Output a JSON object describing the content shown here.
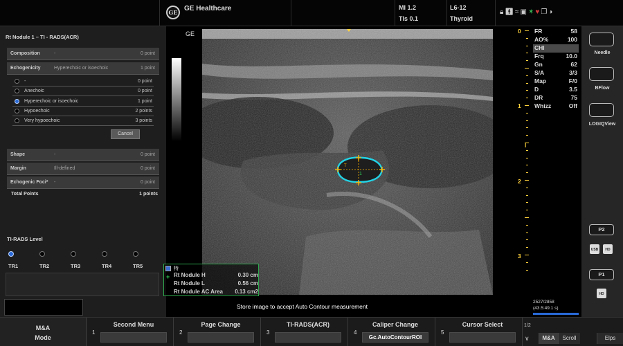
{
  "header": {
    "brand": "GE Healthcare",
    "logo_text": "GE",
    "mi": "MI 1.2",
    "tis": "TIs 0.1",
    "probe": "L6-12",
    "preset": "Thyroid",
    "status_icons": [
      "lock-icon",
      "person-icon",
      "network-icon",
      "save-icon",
      "bluetooth-icon",
      "heart-icon",
      "printer-icon",
      "contrast-icon"
    ]
  },
  "left_panel": {
    "title": "Rt Nodule 1 – TI - RADS(ACR)",
    "categories": [
      {
        "label": "Composition",
        "value": "-",
        "points": "0 point"
      },
      {
        "label": "Echogenicity",
        "value": "Hyperechoic or isoechoic",
        "points": "1 point"
      }
    ],
    "options": [
      {
        "label": "-",
        "points": "0 point",
        "selected": false
      },
      {
        "label": "Anechoic",
        "points": "0 point",
        "selected": false
      },
      {
        "label": "Hyperechoic or isoechoic",
        "points": "1 point",
        "selected": true
      },
      {
        "label": "Hypoechoic",
        "points": "2 points",
        "selected": false
      },
      {
        "label": "Very hypoechoic",
        "points": "3 points",
        "selected": false
      }
    ],
    "cancel_label": "Cancel",
    "lower_categories": [
      {
        "label": "Shape",
        "value": "-",
        "points": "0 point"
      },
      {
        "label": "Margin",
        "value": "Ill-defined",
        "points": "0 point"
      },
      {
        "label": "Echogenic Foci*",
        "value": "-",
        "points": "0 point"
      }
    ],
    "total_label": "Total Points",
    "total_value": "1 points",
    "tirads_title": "TI-RADS Level",
    "levels": [
      "TR1",
      "TR2",
      "TR3",
      "TR4",
      "TR5"
    ],
    "selected_level": "TR1"
  },
  "image": {
    "ge_tag": "GE",
    "depth_labels": [
      "0",
      "1",
      "2",
      "3"
    ],
    "focus_symbol": "I",
    "measurements": {
      "header": "特",
      "rows": [
        {
          "label": "Rt  Nodule H",
          "value": "0.30 cm"
        },
        {
          "label": "Rt  Nodule L",
          "value": "0.56 cm"
        },
        {
          "label": "Rt  Nodule AC Area",
          "value": "0.13 cm2"
        }
      ]
    },
    "message": "Store image to accept Auto Contour measurement",
    "caliper_marks": [
      "T",
      "1"
    ]
  },
  "params": [
    {
      "k": "FR",
      "v": "58"
    },
    {
      "k": "AO%",
      "v": "100"
    },
    {
      "k": "CHI",
      "v": "",
      "highlight": true
    },
    {
      "k": "Frq",
      "v": "10.0"
    },
    {
      "k": "Gn",
      "v": "62"
    },
    {
      "k": "S/A",
      "v": "3/3"
    },
    {
      "k": "Map",
      "v": "F/0"
    },
    {
      "k": "D",
      "v": "3.5"
    },
    {
      "k": "DR",
      "v": "75"
    },
    {
      "k": "Whizz",
      "v": "Off"
    }
  ],
  "frame": {
    "count": "2527/2858",
    "time": "(43.5:49.1 s)"
  },
  "right_buttons": {
    "needle": "Needle",
    "bflow": "BFlow",
    "logiqview": "LOGIQView",
    "p2": "P2",
    "p1": "P1",
    "usb": "USB",
    "hd": "HD"
  },
  "bottom": {
    "mode_line1": "M&A",
    "mode_line2": "Mode",
    "softkeys": [
      {
        "num": "1",
        "label": "Second Menu",
        "value": ""
      },
      {
        "num": "2",
        "label": "Page Change",
        "value": ""
      },
      {
        "num": "3",
        "label": "TI-RADS(ACR)",
        "value": ""
      },
      {
        "num": "4",
        "label": "Caliper Change",
        "value": "Gc.AutoContourROI"
      },
      {
        "num": "5",
        "label": "Cursor Select",
        "value": ""
      }
    ],
    "page": "1/2",
    "ma": "M&A",
    "scroll": "Scroll",
    "elps": "Elps"
  },
  "colors": {
    "accent": "#2a6ad8",
    "depth": "#ffd23c",
    "contour": "#22d3e6",
    "caliper": "#ffb400",
    "meas_border": "#2ea84d"
  }
}
